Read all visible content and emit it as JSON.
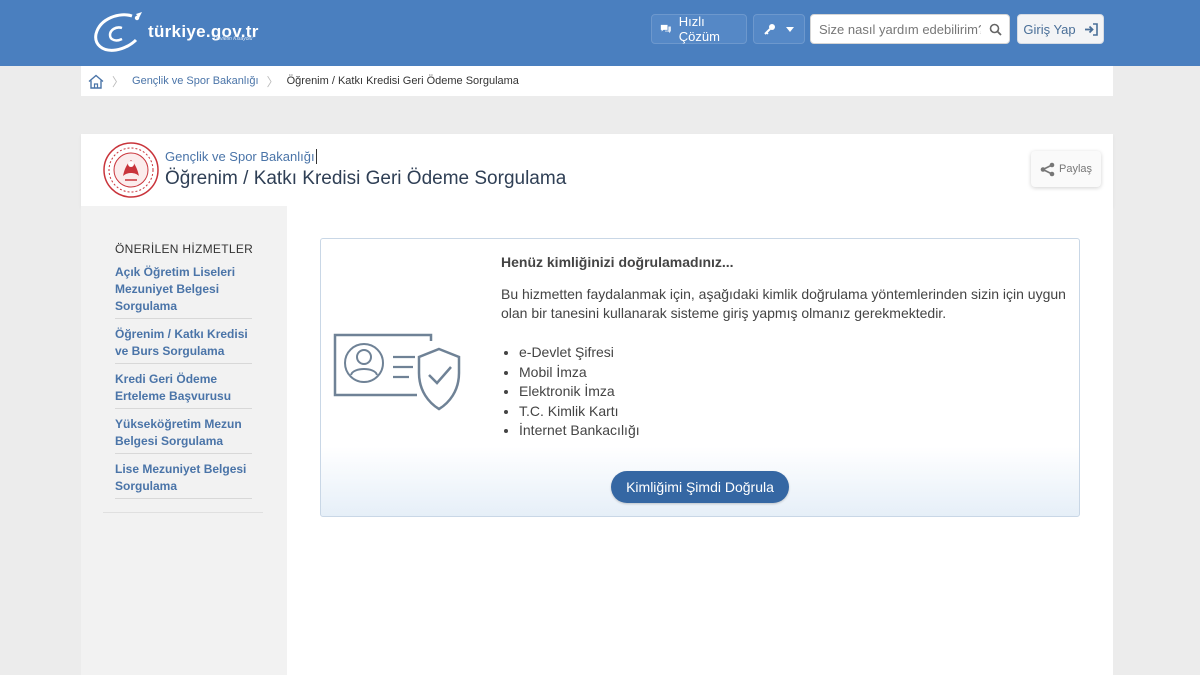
{
  "header": {
    "logo_text": "türkiye.gov.tr",
    "logo_tagline": "\"Devletin Kısayolu\"",
    "quick_solution_label": "Hızlı Çözüm",
    "search_placeholder": "Size nasıl yardım edebilirim?",
    "login_label": "Giriş Yap"
  },
  "breadcrumb": {
    "items": [
      "Gençlik ve Spor Bakanlığı",
      "Öğrenim / Katkı Kredisi Geri Ödeme Sorgulama"
    ]
  },
  "page": {
    "ministry": "Gençlik ve Spor Bakanlığı",
    "title": "Öğrenim / Katkı Kredisi Geri Ödeme Sorgulama",
    "share_label": "Paylaş"
  },
  "sidebar": {
    "title": "ÖNERİLEN HİZMETLER",
    "items": [
      "Açık Öğretim Liseleri Mezuniyet Belgesi Sorgulama",
      "Öğrenim / Katkı Kredisi ve Burs Sorgulama",
      "Kredi Geri Ödeme Erteleme Başvurusu",
      "Yükseköğretim Mezun Belgesi Sorgulama",
      "Lise Mezuniyet Belgesi Sorgulama"
    ]
  },
  "notice": {
    "heading": "Henüz kimliğinizi doğrulamadınız...",
    "text": "Bu hizmetten faydalanmak için, aşağıdaki kimlik doğrulama yöntemlerinden sizin için uygun olan bir tanesini kullanarak sisteme giriş yapmış olmanız gerekmektedir.",
    "methods": [
      "e-Devlet Şifresi",
      "Mobil İmza",
      "Elektronik İmza",
      "T.C. Kimlik Kartı",
      "İnternet Bankacılığı"
    ],
    "button_label": "Kimliğimi Şimdi Doğrula"
  },
  "colors": {
    "header_bg": "#4a7fbf",
    "link": "#4a74a8",
    "primary_button": "#3567a3"
  },
  "icons": [
    "logo-icon",
    "chat-icon",
    "key-icon",
    "chevron-down-icon",
    "search-icon",
    "login-icon",
    "home-icon",
    "ministry-emblem-icon",
    "share-icon",
    "id-card-shield-icon"
  ]
}
